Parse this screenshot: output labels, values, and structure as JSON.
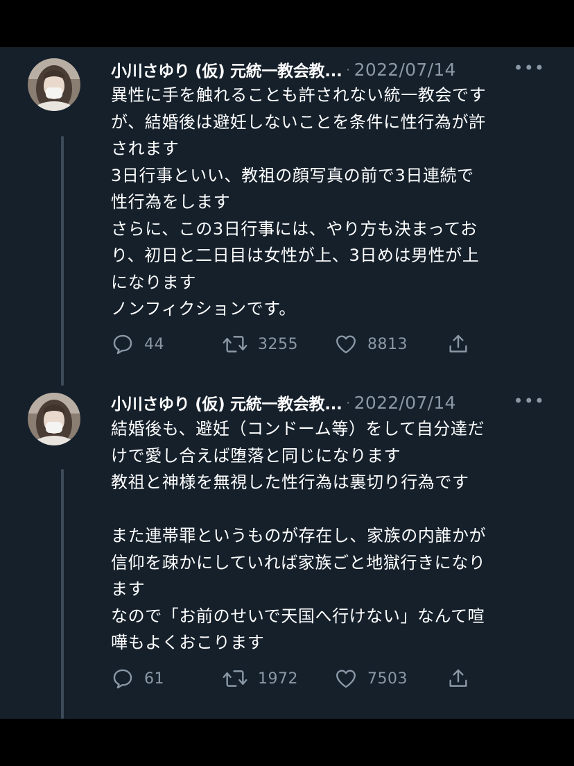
{
  "colors": {
    "background": "#15202b",
    "outer": "#000000",
    "text": "#ffffff",
    "muted": "#8b98a5",
    "thread_line": "#3d4a59"
  },
  "tweets": [
    {
      "author": "小川さゆり (仮) 元統一教会教...",
      "separator": "·",
      "date": "2022/07/14",
      "more_icon": "more-horizontal-icon",
      "lines": [
        "異性に手を触れることも許されない統一教会です",
        "が、結婚後は避妊しないことを条件に性行為が許",
        "されます",
        "3日行事といい、教祖の顔写真の前で3日連続で",
        "性行為をします",
        "さらに、この3日行事には、やり方も決まってお",
        "り、初日と二日目は女性が上、3日めは男性が上",
        "になります",
        "ノンフィクションです。"
      ],
      "replies": "44",
      "retweets": "3255",
      "likes": "8813"
    },
    {
      "author": "小川さゆり (仮) 元統一教会教...",
      "separator": "·",
      "date": "2022/07/14",
      "more_icon": "more-horizontal-icon",
      "lines": [
        "結婚後も、避妊（コンドーム等）をして自分達だ",
        "けで愛し合えば堕落と同じになります",
        "教祖と神様を無視した性行為は裏切り行為です",
        "",
        "また連帯罪というものが存在し、家族の内誰かが",
        "信仰を疎かにしていれば家族ごと地獄行きになり",
        "ます",
        "なので「お前のせいで天国へ行けない」なんて喧",
        "嘩もよくおこります"
      ],
      "replies": "61",
      "retweets": "1972",
      "likes": "7503"
    }
  ]
}
